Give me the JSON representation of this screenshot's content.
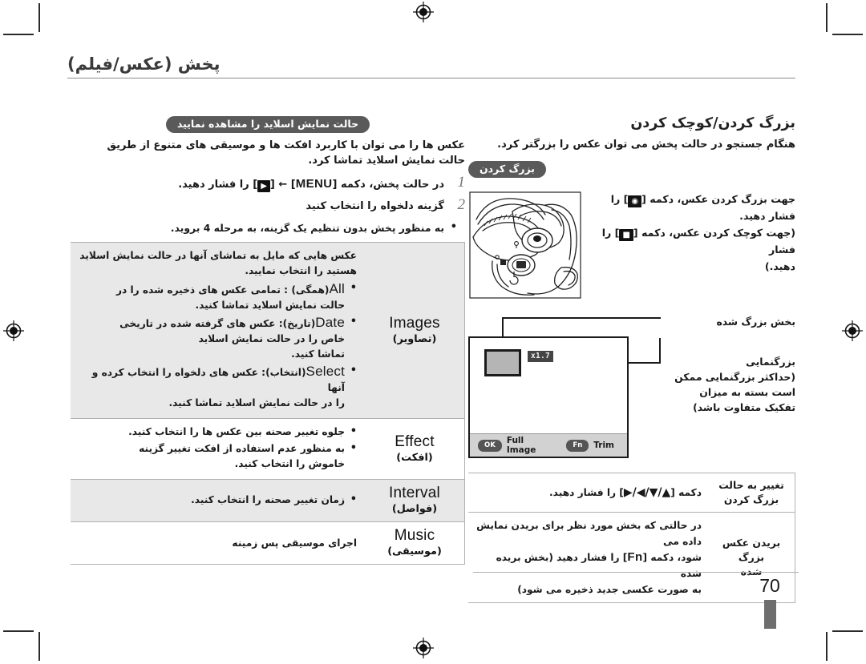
{
  "header": {
    "title": "پخش (عکس/فیلم)"
  },
  "page": {
    "number": "70"
  },
  "right_column": {
    "section_title": "بزرگ کردن/کوچک کردن",
    "intro": "هنگام جستجو در حالت پخش می توان عکس را بزرگتر کرد.",
    "badge": "بزرگ کردن",
    "instruction_line1": "جهت بزرگ کردن عکس، دکمه [",
    "instruction_line1b": "] را فشار دهید.",
    "instruction_line2": "(جهت کوچک کردن عکس، دکمه [",
    "instruction_line2b": "] را فشار",
    "instruction_line3": "دهید.)",
    "lcd": {
      "zoom_value": "x1.7",
      "ok_key": "OK",
      "ok_label": "Full Image",
      "fn_key": "Fn",
      "fn_label": "Trim"
    },
    "callout_top": "بخش بزرگ شده",
    "callout_bottom_l1": "بزرگنمایی",
    "callout_bottom_l2": "(حداکثر بزرگنمایی ممکن",
    "callout_bottom_l3": "است بسته به میزان",
    "callout_bottom_l4": "تفکیک متفاوت باشد)",
    "table": {
      "rows": [
        {
          "label_l1": "تغییر به حالت",
          "label_l2": "بزرگ کردن",
          "desc_pre": "دکمه [",
          "desc_glyph": "▲/▼/◀/▶",
          "desc_post": "] را فشار دهید."
        },
        {
          "label_l1": "بریدن عکس بزرگ",
          "label_l2": "شده",
          "desc_l1": "در حالتی که بخش مورد نظر برای بریدن نمایش داده می",
          "desc_l2_pre": "شود، دکمه [",
          "desc_l2_key": "Fn",
          "desc_l2_post": "] را فشار دهید (بخش بریده شده",
          "desc_l3": "به صورت عکسی جدید ذخیره می شود)"
        }
      ]
    }
  },
  "left_column": {
    "badge": "حالت نمایش اسلاید را مشاهده نمایید",
    "intro_l1": "عکس ها را می توان با کاربرد افکت ها و موسیقی های متنوع از طریق",
    "intro_l2": "حالت نمایش اسلاید تماشا کرد.",
    "steps": [
      {
        "num": "1",
        "pre": "در حالت پخش، دکمه [",
        "token": "MENU",
        "mid": "] ← [",
        "glyph": "▶",
        "post": "] را فشار دهید."
      },
      {
        "num": "2",
        "text": "گزینه دلخواه را انتخاب کنید"
      }
    ],
    "sub_bullet": "به منظور پخش بدون تنظیم یک گزینه، به مرحله 4 بروید.",
    "table": {
      "rows": [
        {
          "label_en": "Images",
          "label_fa": "(تصاویر)",
          "shaded": true,
          "intro_l1": "عکس هایی که مایل به تماشای آنها در حالت نمایش اسلاید",
          "intro_l2": "هستید را انتخاب نمایید.",
          "items": [
            {
              "en": "All",
              "fa": "(همگی)",
              "sep": " : ",
              "desc_l1": "تمامی عکس های ذخیره شده را در",
              "desc_l2": "حالت نمایش اسلاید تماشا کنید."
            },
            {
              "en": "Date",
              "fa": "(تاریخ)",
              "sep": ": ",
              "desc_l1": "عکس های گرفته شده در تاریخی",
              "desc_l2": "خاص را در حالت نمایش اسلاید",
              "desc_l3": "تماشا کنید."
            },
            {
              "en": "Select",
              "fa": "(انتخاب)",
              "sep": ": ",
              "desc_l1": "عکس های دلخواه را انتخاب کرده و آنها",
              "desc_l2": "را در حالت نمایش اسلاید تماشا کنید."
            }
          ]
        },
        {
          "label_en": "Effect",
          "label_fa": "(افکت)",
          "shaded": false,
          "items": [
            {
              "desc_l1": "جلوه تغییر صحنه بین عکس ها را انتخاب کنید."
            },
            {
              "desc_l1": "به منظور عدم استفاده از افکت تغییر گزینه",
              "desc_l2": "خاموش را انتخاب کنید."
            }
          ]
        },
        {
          "label_en": "Interval",
          "label_fa": "(فواصل)",
          "shaded": true,
          "items": [
            {
              "desc_l1": "زمان تغییر صحنه را انتخاب کنید."
            }
          ]
        },
        {
          "label_en": "Music",
          "label_fa": "(موسیقی)",
          "shaded": false,
          "plain": "اجرای موسیقی پس زمینه"
        }
      ]
    }
  }
}
